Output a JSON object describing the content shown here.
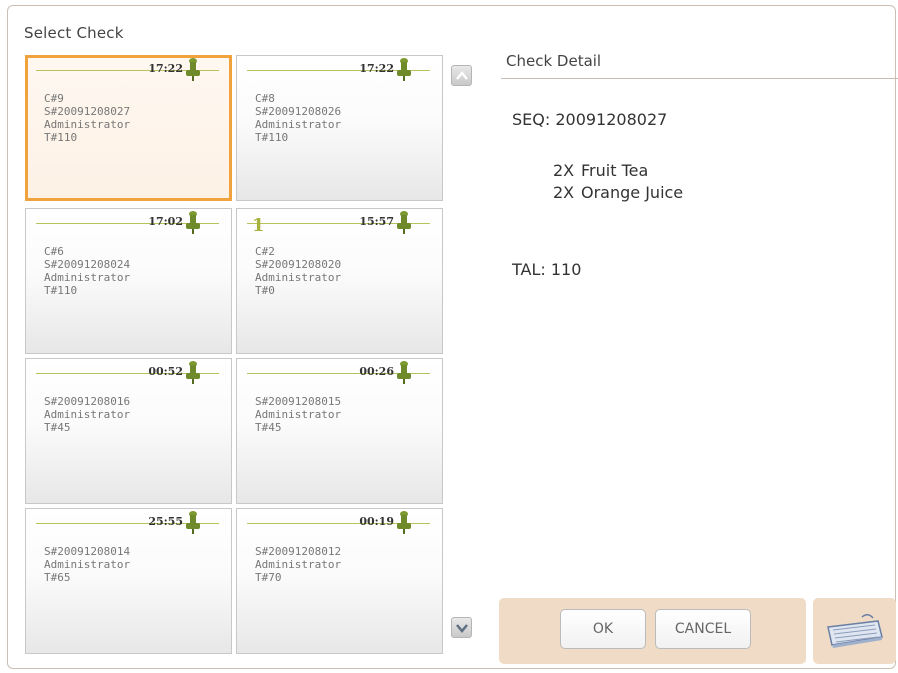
{
  "dialog": {
    "title": "Select Check"
  },
  "checks": [
    {
      "time": "17:22",
      "num": "",
      "lines": [
        "C#9",
        "S#20091208027",
        "Administrator",
        "T#110"
      ],
      "selected": true
    },
    {
      "time": "17:22",
      "num": "",
      "lines": [
        "C#8",
        "S#20091208026",
        "Administrator",
        "T#110"
      ],
      "selected": false
    },
    {
      "time": "17:02",
      "num": "",
      "lines": [
        "C#6",
        "S#20091208024",
        "Administrator",
        "T#110"
      ],
      "selected": false
    },
    {
      "time": "15:57",
      "num": "1",
      "lines": [
        "C#2",
        "S#20091208020",
        "Administrator",
        "T#0"
      ],
      "selected": false
    },
    {
      "time": "00:52",
      "num": "",
      "lines": [
        "S#20091208016",
        "Administrator",
        "T#45"
      ],
      "selected": false
    },
    {
      "time": "00:26",
      "num": "",
      "lines": [
        "S#20091208015",
        "Administrator",
        "T#45"
      ],
      "selected": false
    },
    {
      "time": "25:55",
      "num": "",
      "lines": [
        "S#20091208014",
        "Administrator",
        "T#65"
      ],
      "selected": false
    },
    {
      "time": "00:19",
      "num": "",
      "lines": [
        "S#20091208012",
        "Administrator",
        "T#70"
      ],
      "selected": false
    }
  ],
  "detail": {
    "title": "Check Detail",
    "seq": "SEQ: 20091208027",
    "items": [
      {
        "qty": "2X",
        "name": "Fruit Tea"
      },
      {
        "qty": "2X",
        "name": "Orange Juice"
      }
    ],
    "tal": "TAL: 110"
  },
  "buttons": {
    "ok": "OK",
    "cancel": "CANCEL"
  },
  "icons": {
    "pin": "pushpin-icon",
    "scroll_up": "chevron-up-icon",
    "scroll_down": "chevron-down-icon",
    "keyboard": "keyboard-icon"
  },
  "colors": {
    "selected_border": "#f0a23c",
    "action_bar": "#f0dcc6",
    "pin": "#6e8a2a",
    "accent_line": "#b8c25a"
  }
}
